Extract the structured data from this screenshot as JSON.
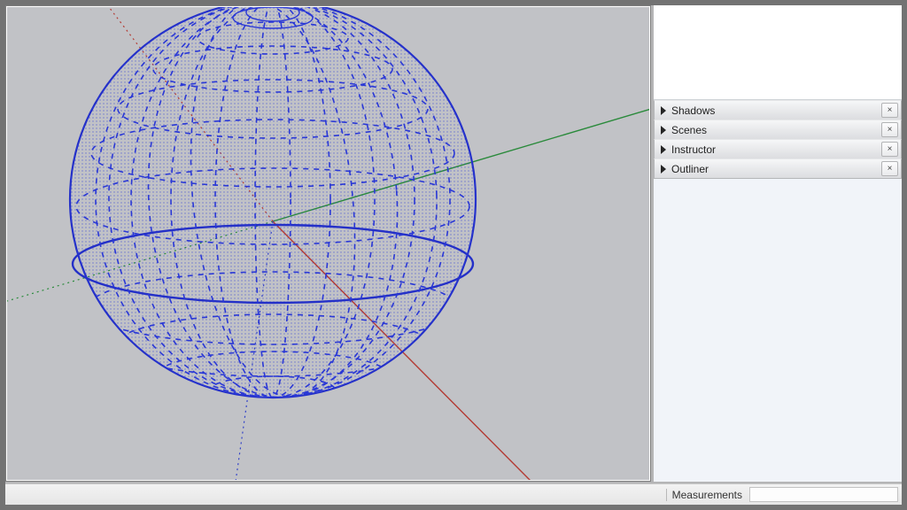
{
  "panels": {
    "items": [
      {
        "label": "Shadows"
      },
      {
        "label": "Scenes"
      },
      {
        "label": "Instructor"
      },
      {
        "label": "Outliner"
      }
    ],
    "close_glyph": "×"
  },
  "status": {
    "measurements_label": "Measurements",
    "measurements_value": ""
  },
  "viewport": {
    "axes": {
      "red": "red-axis",
      "green": "green-axis",
      "blue": "blue-axis"
    },
    "object": "sphere-wireframe"
  }
}
